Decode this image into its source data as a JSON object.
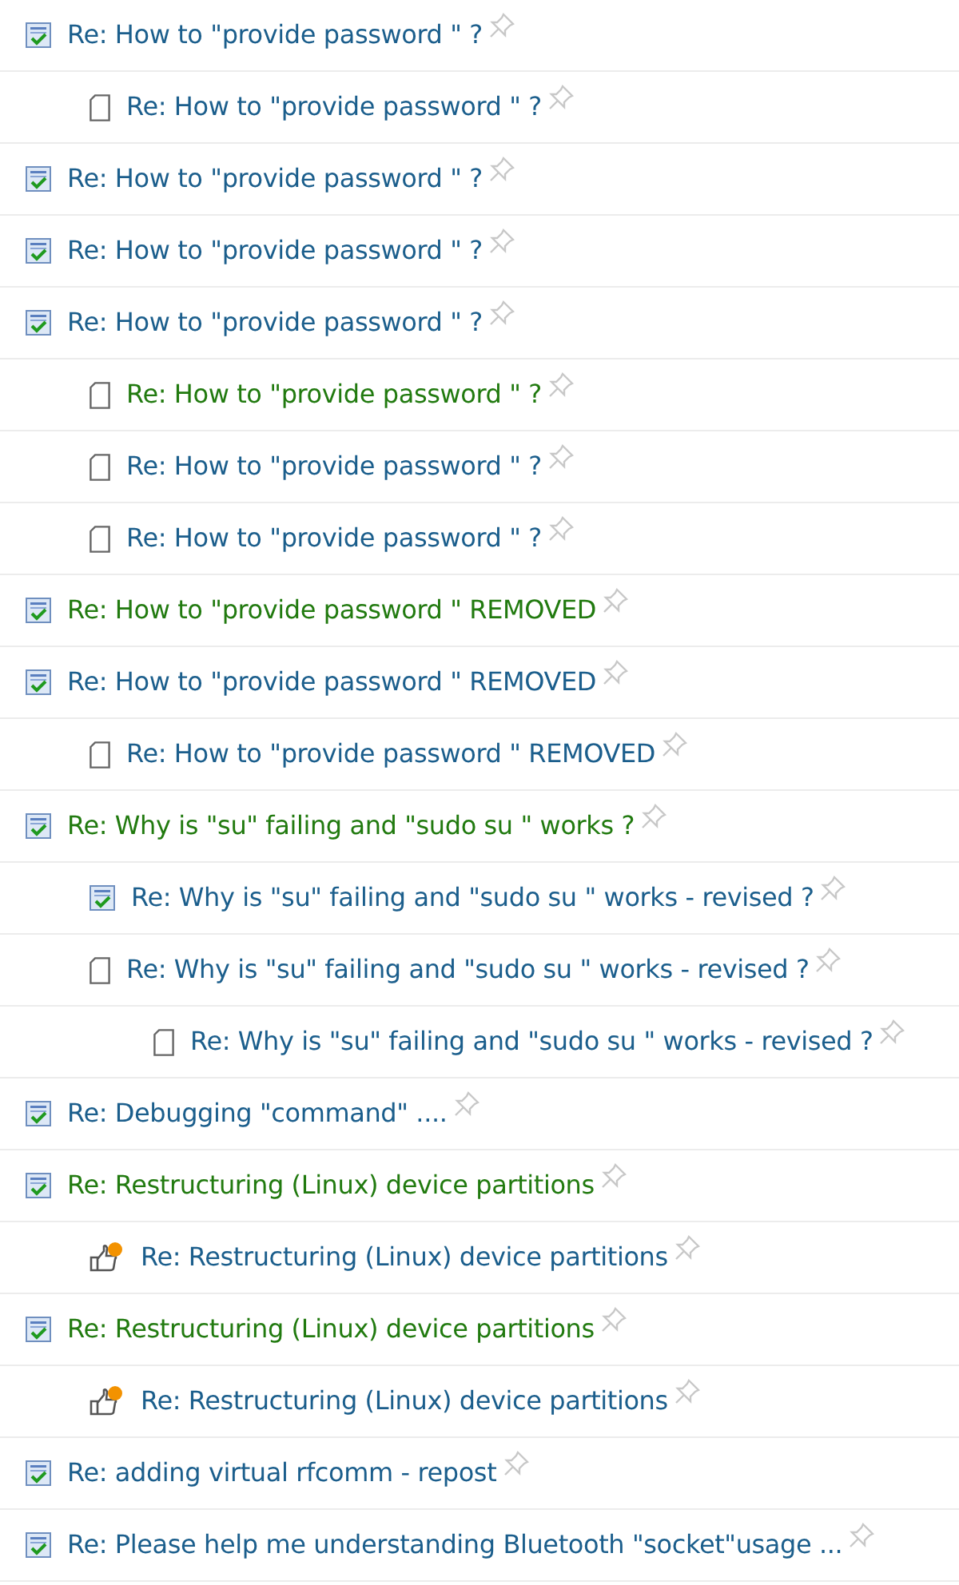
{
  "threads": [
    {
      "kind": "solved",
      "title": "Re: How to \"provide password \" ?",
      "accepted": false,
      "children": [
        {
          "kind": "page",
          "title": "Re: How to \"provide password \" ?",
          "accepted": false
        }
      ]
    },
    {
      "kind": "solved",
      "title": "Re: How to \"provide password \" ?",
      "accepted": false
    },
    {
      "kind": "solved",
      "title": "Re: How to \"provide password \" ?",
      "accepted": false
    },
    {
      "kind": "solved",
      "title": "Re: How to \"provide password \" ?",
      "accepted": false,
      "children": [
        {
          "kind": "page",
          "title": "Re: How to \"provide password \" ?",
          "accepted": true
        },
        {
          "kind": "page",
          "title": "Re: How to \"provide password \" ?",
          "accepted": false
        },
        {
          "kind": "page",
          "title": "Re: How to \"provide password \" ?",
          "accepted": false
        }
      ]
    },
    {
      "kind": "solved",
      "title": "Re: How to \"provide password \" REMOVED",
      "accepted": true
    },
    {
      "kind": "solved",
      "title": "Re: How to \"provide password \" REMOVED",
      "accepted": false,
      "children": [
        {
          "kind": "page",
          "title": "Re: How to \"provide password \" REMOVED",
          "accepted": false
        }
      ]
    },
    {
      "kind": "solved",
      "title": "Re: Why is \"su\" failing and \"sudo su \" works ?",
      "accepted": true,
      "children": [
        {
          "kind": "solved",
          "title": "Re: Why is \"su\" failing and \"sudo su \" works - revised ?",
          "accepted": false
        },
        {
          "kind": "page",
          "title": "Re: Why is \"su\" failing and \"sudo su \" works - revised ?",
          "accepted": false,
          "children": [
            {
              "kind": "page",
              "title": "Re: Why is \"su\" failing and \"sudo su \" works - revised ?",
              "accepted": false
            }
          ]
        }
      ]
    },
    {
      "kind": "solved",
      "title": "Re: Debugging \"command\" ....",
      "accepted": false
    },
    {
      "kind": "solved",
      "title": "Re: Restructuring (Linux) device partitions",
      "accepted": true,
      "children": [
        {
          "kind": "kudo",
          "title": "Re: Restructuring (Linux) device partitions",
          "accepted": false
        }
      ]
    },
    {
      "kind": "solved",
      "title": "Re: Restructuring (Linux) device partitions",
      "accepted": true,
      "children": [
        {
          "kind": "kudo",
          "title": "Re: Restructuring (Linux) device partitions",
          "accepted": false
        }
      ]
    },
    {
      "kind": "solved",
      "title": "Re: adding virtual rfcomm - repost",
      "accepted": false
    },
    {
      "kind": "solved",
      "title": "Re: Please help me understanding Bluetooth \"socket\"usage ...",
      "accepted": false
    }
  ]
}
